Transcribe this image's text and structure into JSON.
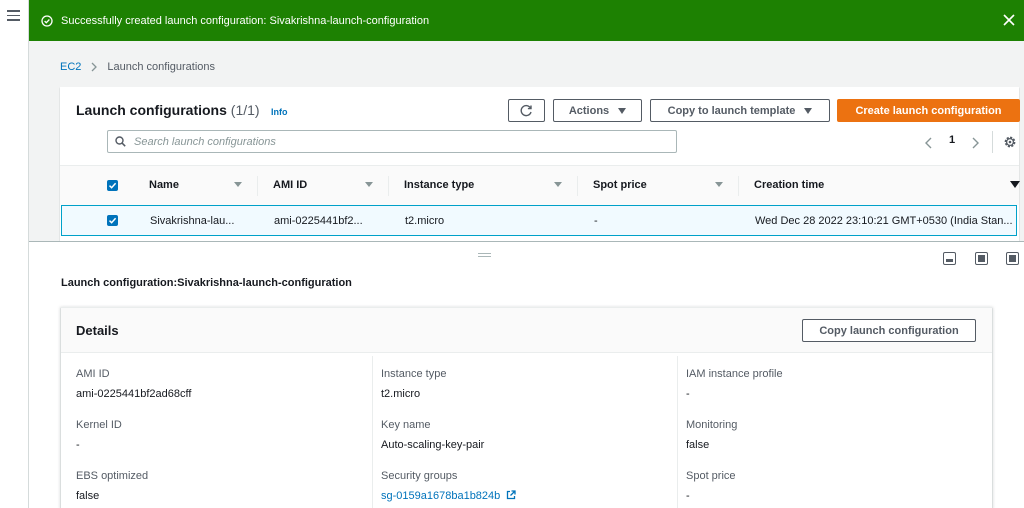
{
  "nav": {
    "menu_icon": "hamburger-icon"
  },
  "flash": {
    "message": "Successfully created launch configuration: Sivakrishna-launch-configuration",
    "color": "#1d8102",
    "icon": "success-check-icon"
  },
  "breadcrumb": {
    "root": "EC2",
    "current": "Launch configurations"
  },
  "table_panel": {
    "title": "Launch configurations",
    "count": "(1/1)",
    "info": "Info",
    "actions_label": "Actions",
    "copy_template_label": "Copy to launch template",
    "create_label": "Create launch configuration",
    "search_placeholder": "Search launch configurations",
    "page_number": "1",
    "accent": "#ec7211"
  },
  "table": {
    "columns": [
      "Name",
      "AMI ID",
      "Instance type",
      "Spot price",
      "Creation time"
    ],
    "rows": [
      {
        "name": "Sivakrishna-lau...",
        "ami_id": "ami-0225441bf2...",
        "instance_type": "t2.micro",
        "spot_price": "-",
        "creation_time": "Wed Dec 28 2022 23:10:21 GMT+0530 (India Stan..."
      }
    ]
  },
  "detail": {
    "title": "Launch configuration:Sivakrishna-launch-configuration",
    "details_heading": "Details",
    "copy_button": "Copy launch configuration",
    "fields": {
      "ami_id": {
        "label": "AMI ID",
        "value": "ami-0225441bf2ad68cff"
      },
      "instance_type": {
        "label": "Instance type",
        "value": "t2.micro"
      },
      "iam_profile": {
        "label": "IAM instance profile",
        "value": "-"
      },
      "kernel_id": {
        "label": "Kernel ID",
        "value": "-"
      },
      "key_name": {
        "label": "Key name",
        "value": "Auto-scaling-key-pair"
      },
      "monitoring": {
        "label": "Monitoring",
        "value": "false"
      },
      "ebs_optimized": {
        "label": "EBS optimized",
        "value": "false"
      },
      "security_groups": {
        "label": "Security groups",
        "value": "sg-0159a1678ba1b824b"
      },
      "spot_price": {
        "label": "Spot price",
        "value": "-"
      }
    }
  }
}
